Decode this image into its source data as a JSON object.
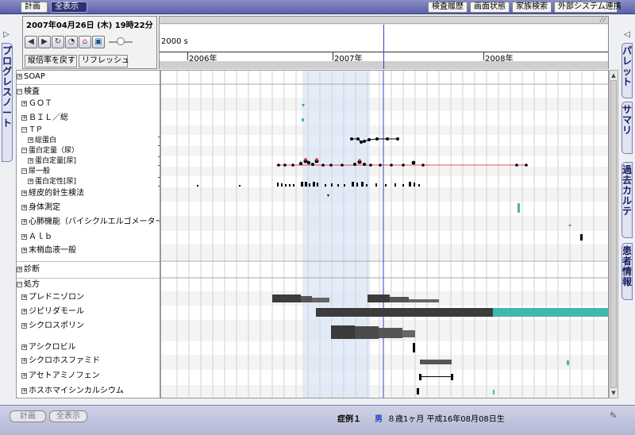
{
  "topbar": {
    "left_buttons": [
      "計画",
      "全表示"
    ],
    "right_buttons": [
      "検査履歴",
      "画面状態",
      "家族検索",
      "外部システム連携"
    ]
  },
  "side_tabs": {
    "left": "プログレスノート",
    "right": [
      "パレット",
      "サマリ",
      "過去カルテ",
      "患者情報"
    ]
  },
  "control_panel": {
    "datetime": "2007年04月26日 (木) 19時22分",
    "reset_zoom_label": "縦倍率を戻す",
    "refresh_label": "リフレッシュ",
    "icons": [
      "back-arrow-icon",
      "forward-arrow-icon",
      "refresh-icon",
      "clock-icon",
      "home-icon",
      "save-icon"
    ]
  },
  "timeline": {
    "scale_label": "2000 s",
    "years": [
      "2006年",
      "2007年",
      "2008年"
    ]
  },
  "tree": {
    "soap": "SOAP",
    "kensa": "検査",
    "got": "ＧＯＴ",
    "bil": "ＢＩＬ／総",
    "tp": "ＴＰ",
    "soutanpaku": "総蛋白",
    "tanpaku_teiryo_nyo": "蛋白定量（尿）",
    "tanpaku_teiryo": "蛋白定量[尿]",
    "nyo_ippan": "尿一般",
    "tanpaku_teisei": "蛋白定性[尿]",
    "keihi": "経皮的針生検法",
    "shintai": "身体測定",
    "shinpai": "心肺機能（バイシクルエルゴメーター）",
    "alb": "Ａｌｂ",
    "masho": "末梢血液一般",
    "shindan": "診断",
    "shoho": "処方",
    "drugs": [
      "プレドニゾロン",
      "ジピリダモール",
      "シクロスポリン",
      "アシクロビル",
      "シクロホスファミド",
      "アセトアミノフェン",
      "ホスホマイシンカルシウム"
    ]
  },
  "bottom": {
    "left_buttons": [
      "計画",
      "全表示"
    ],
    "patient_label": "症例１",
    "sex": "男",
    "age_birth": "８歳1ヶ月 平成16年08月08日生"
  },
  "colors": {
    "topbar": "#5a60a6",
    "highlight": "#dbe6f7",
    "red_line": "#e04848",
    "teal": "#3fb8b0",
    "dark_bar": "#3c3c3c"
  }
}
